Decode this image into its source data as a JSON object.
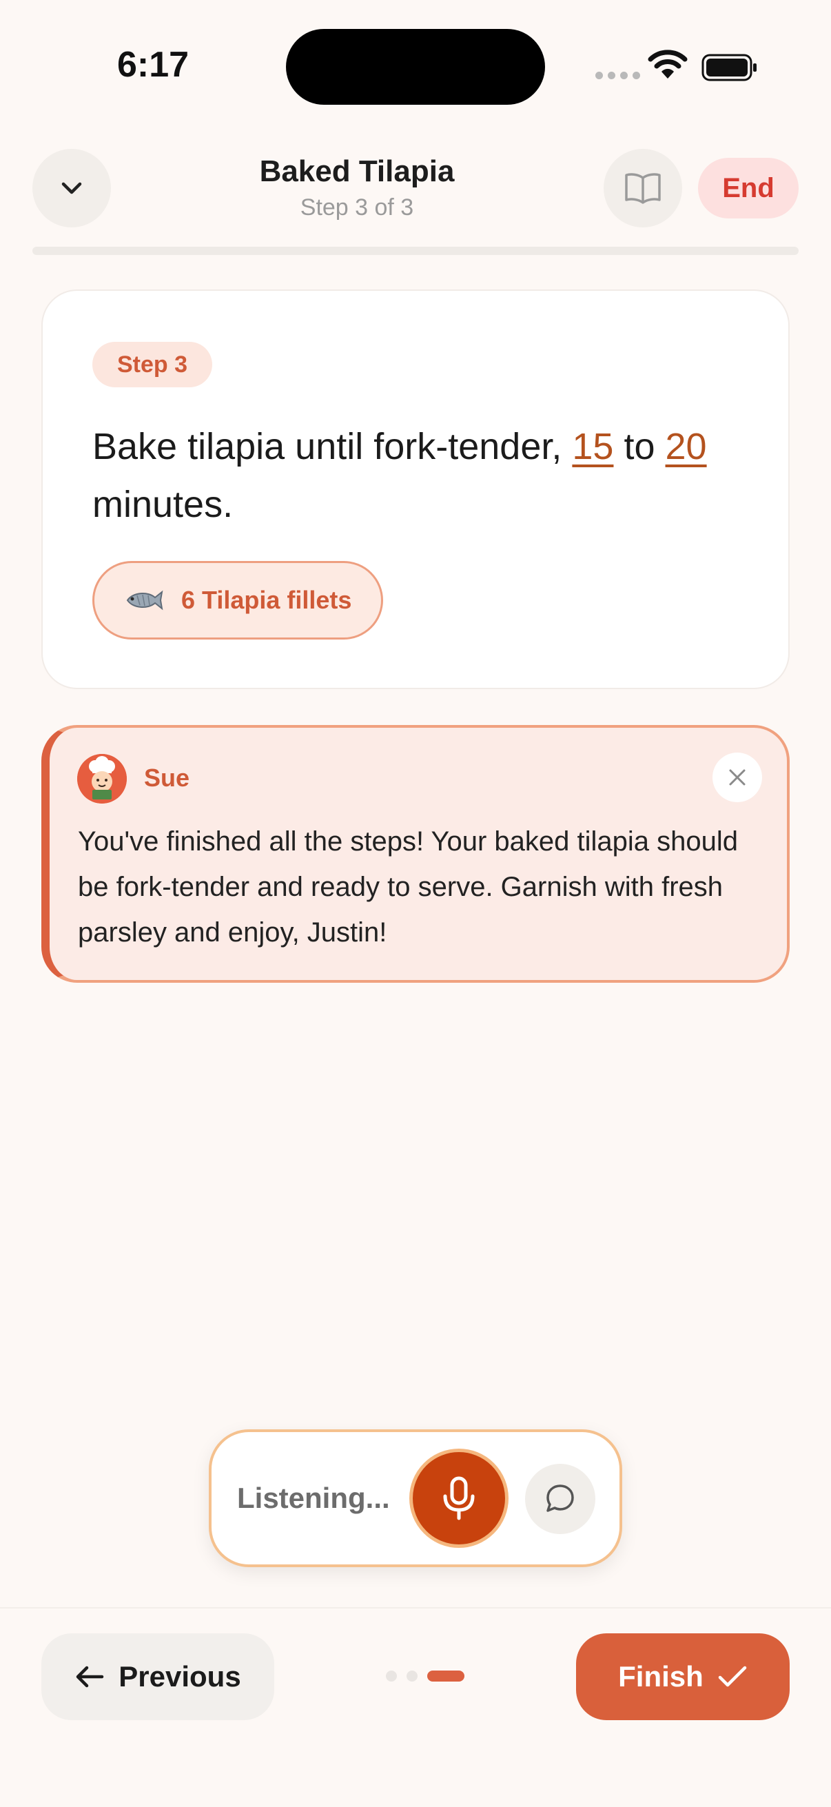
{
  "status_bar": {
    "time": "6:17"
  },
  "header": {
    "title": "Baked Tilapia",
    "subtitle": "Step 3 of 3",
    "end_label": "End",
    "progress": 1.0
  },
  "step_card": {
    "badge": "Step 3",
    "instruction_prefix": "Bake tilapia until fork-tender, ",
    "time_min": "15",
    "instruction_join": " to ",
    "time_max": "20",
    "instruction_suffix": " minutes.",
    "ingredient": {
      "icon": "fish-icon",
      "label": "6 Tilapia fillets"
    }
  },
  "assistant": {
    "name": "Sue",
    "message": "You've finished all the steps! Your baked tilapia should be fork-tender and ready to serve. Garnish with fresh parsley and enjoy, Justin!"
  },
  "voice_bar": {
    "status": "Listening..."
  },
  "navigation": {
    "previous_label": "Previous",
    "finish_label": "Finish",
    "page_count": 3,
    "current_page": 3
  },
  "colors": {
    "accent": "#d9603b",
    "mic": "#c8420d",
    "end_text": "#d63b30",
    "background": "#fdf8f5"
  }
}
